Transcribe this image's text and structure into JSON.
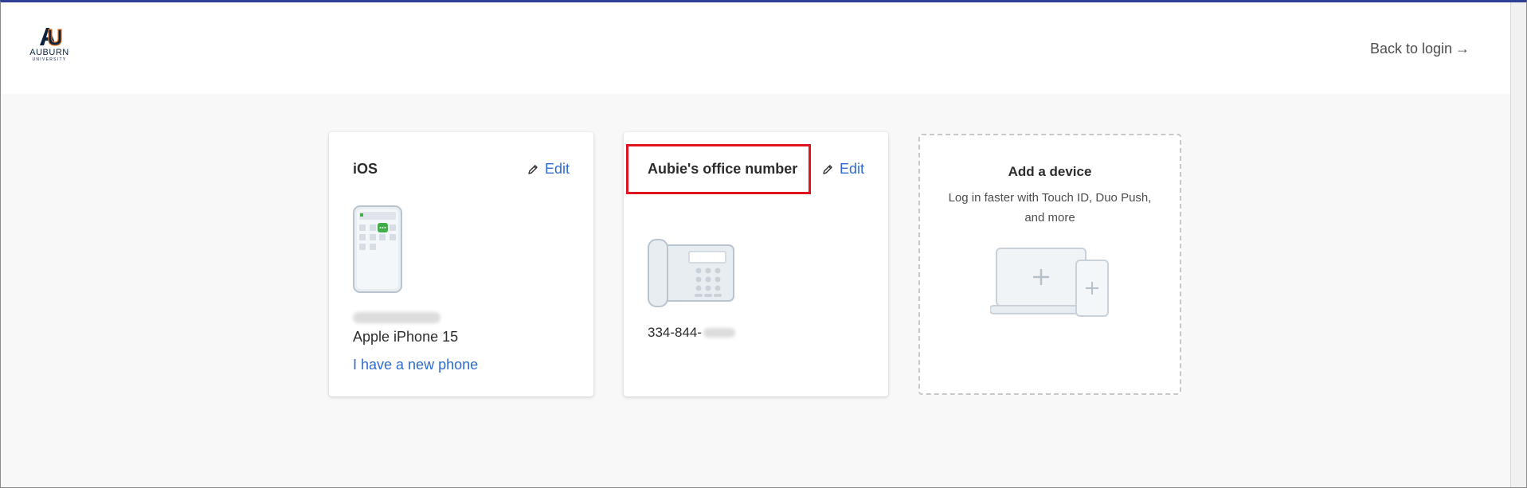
{
  "header": {
    "logo_main": "AUBURN",
    "logo_sub": "UNIVERSITY",
    "back_link": "Back to login",
    "back_arrow": "→"
  },
  "devices": [
    {
      "title": "iOS",
      "edit_label": "Edit",
      "model": "Apple iPhone 15",
      "new_phone_link": "I have a new phone"
    },
    {
      "title": "Aubie's office number",
      "edit_label": "Edit",
      "phone_number_prefix": "334-844-"
    }
  ],
  "add_device": {
    "title": "Add a device",
    "description": "Log in faster with Touch ID, Duo Push, and more"
  },
  "colors": {
    "accent_link": "#2f6bd1",
    "highlight": "#e0141e",
    "top_bar": "#2e3f95"
  },
  "icons": {
    "edit": "pencil-icon",
    "back": "arrow-right-icon"
  }
}
